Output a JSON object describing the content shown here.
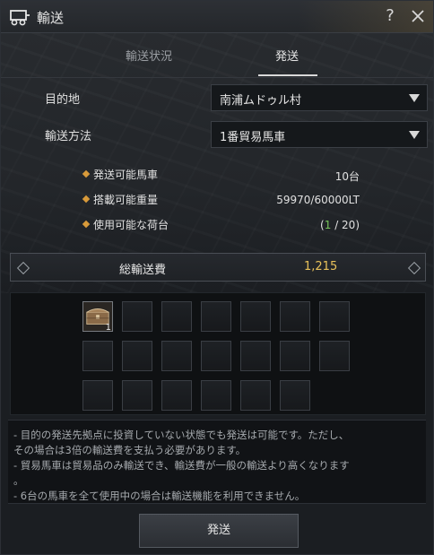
{
  "window": {
    "title": "輸送",
    "help_label": "?"
  },
  "tabs": [
    {
      "label": "輸送状況",
      "active": false
    },
    {
      "label": "発送",
      "active": true
    }
  ],
  "form": {
    "destination": {
      "label": "目的地",
      "value": "南浦ムドゥル村"
    },
    "method": {
      "label": "輸送方法",
      "value": "1番貿易馬車"
    }
  },
  "stats": {
    "available_wagons": {
      "label": "発送可能馬車",
      "value": "10台"
    },
    "load_weight": {
      "label": "搭載可能重量",
      "value": "59970/60000LT"
    },
    "cargo_slots": {
      "label": "使用可能な荷台",
      "open": "(",
      "used": "1",
      "rest": " / 20)"
    }
  },
  "cost": {
    "label": "総輸送費",
    "value": "1,215"
  },
  "slots": {
    "total_visible": 20,
    "filled": [
      {
        "index": 0,
        "count": "1",
        "icon": "treasure-chest-icon"
      }
    ]
  },
  "notes": [
    "- 目的の発送先拠点に投資していない状態でも発送は可能です。ただし、",
    "その場合は3倍の輸送費を支払う必要があります。",
    "- 貿易馬車は貿易品のみ輸送でき、輸送費が一般の輸送より高くなります",
    "。",
    "- 6台の馬車を全て使用中の場合は輸送機能を利用できません。"
  ],
  "send_button": {
    "label": "発送"
  },
  "colors": {
    "accent_gold": "#e8c15a",
    "diamond_orange": "#d89a3a",
    "used_green": "#76c45a"
  }
}
